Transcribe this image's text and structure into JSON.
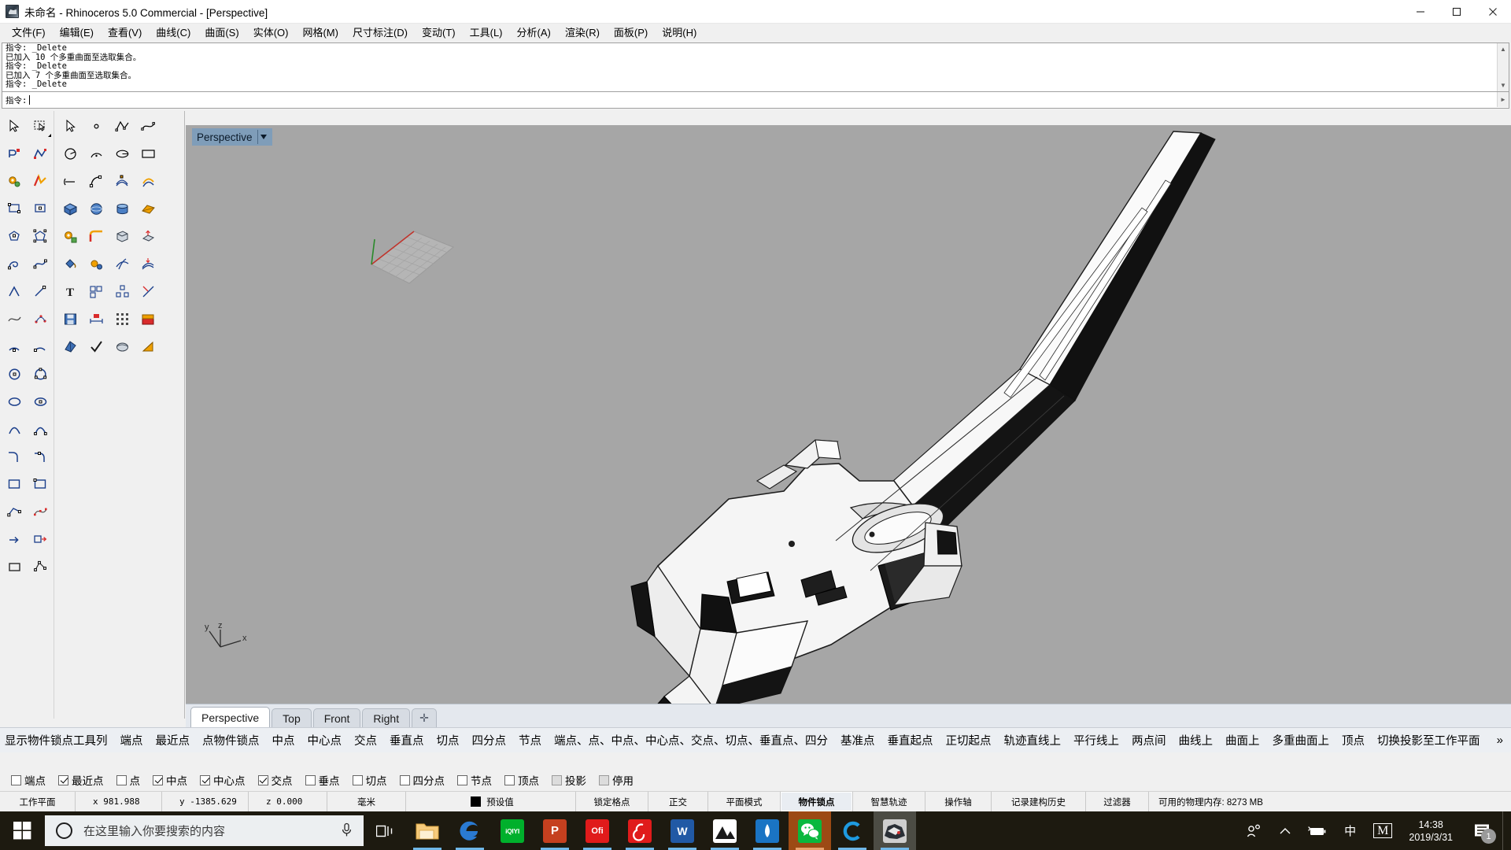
{
  "window": {
    "title": "未命名 - Rhinoceros 5.0 Commercial - [Perspective]",
    "icon": "rhino-logo-icon",
    "minimize_label": "最小化",
    "maximize_label": "最大化",
    "close_label": "关闭"
  },
  "menu": {
    "items": [
      {
        "label": "文件(F)"
      },
      {
        "label": "编辑(E)"
      },
      {
        "label": "查看(V)"
      },
      {
        "label": "曲线(C)"
      },
      {
        "label": "曲面(S)"
      },
      {
        "label": "实体(O)"
      },
      {
        "label": "网格(M)"
      },
      {
        "label": "尺寸标注(D)"
      },
      {
        "label": "变动(T)"
      },
      {
        "label": "工具(L)"
      },
      {
        "label": "分析(A)"
      },
      {
        "label": "渲染(R)"
      },
      {
        "label": "面板(P)"
      },
      {
        "label": "说明(H)"
      }
    ]
  },
  "command": {
    "history": [
      "指令: _Delete",
      "已加入 10 个多重曲面至选取集合。",
      "指令: _Delete",
      "已加入 7 个多重曲面至选取集合。",
      "指令: _Delete"
    ],
    "prompt_label": "指令: ",
    "prompt_value": "",
    "scroll_up": "▲",
    "scroll_down": "▼",
    "scroll_left": "◄",
    "scroll_right": "►"
  },
  "viewport": {
    "label": "Perspective",
    "dropdown_icon": "chevron-down-icon",
    "background_color": "#a6a6a6",
    "axis_labels": {
      "x": "x",
      "y": "y",
      "z": "z"
    },
    "tabs": [
      {
        "label": "Perspective",
        "active": true
      },
      {
        "label": "Top",
        "active": false
      },
      {
        "label": "Front",
        "active": false
      },
      {
        "label": "Right",
        "active": false
      }
    ],
    "add_tab_label": "✛"
  },
  "osnap_toolbar": {
    "items": [
      "显示物件锁点工具列",
      "端点",
      "最近点",
      "点物件锁点",
      "中点",
      "中心点",
      "交点",
      "垂直点",
      "切点",
      "四分点",
      "节点",
      "端点、点、中点、中心点、交点、切点、垂直点、四分",
      "基准点",
      "垂直起点",
      "正切起点",
      "轨迹直线上",
      "平行线上",
      "两点间",
      "曲线上",
      "曲面上",
      "多重曲面上",
      "顶点",
      "切换投影至工作平面"
    ],
    "overflow_label": "»"
  },
  "osnap_checks": [
    {
      "label": "端点",
      "checked": false,
      "disabled": false
    },
    {
      "label": "最近点",
      "checked": true,
      "disabled": false
    },
    {
      "label": "点",
      "checked": false,
      "disabled": false
    },
    {
      "label": "中点",
      "checked": true,
      "disabled": false
    },
    {
      "label": "中心点",
      "checked": true,
      "disabled": false
    },
    {
      "label": "交点",
      "checked": true,
      "disabled": false
    },
    {
      "label": "垂点",
      "checked": false,
      "disabled": false
    },
    {
      "label": "切点",
      "checked": false,
      "disabled": false
    },
    {
      "label": "四分点",
      "checked": false,
      "disabled": false
    },
    {
      "label": "节点",
      "checked": false,
      "disabled": false
    },
    {
      "label": "顶点",
      "checked": false,
      "disabled": false
    },
    {
      "label": "投影",
      "checked": false,
      "disabled": true
    },
    {
      "label": "停用",
      "checked": false,
      "disabled": true
    }
  ],
  "statusbar": {
    "cplane": "工作平面",
    "x": "x  981.988",
    "y": "y -1385.629",
    "z": "z  0.000",
    "units": "毫米",
    "layer": "预设值",
    "layer_color": "#000000",
    "toggles": [
      {
        "label": "锁定格点",
        "on": false
      },
      {
        "label": "正交",
        "on": false
      },
      {
        "label": "平面模式",
        "on": false
      },
      {
        "label": "物件锁点",
        "on": true
      },
      {
        "label": "智慧轨迹",
        "on": false
      },
      {
        "label": "操作轴",
        "on": false
      },
      {
        "label": "记录建构历史",
        "on": false
      },
      {
        "label": "过滤器",
        "on": false
      }
    ],
    "memory": "可用的物理内存:  8273 MB"
  },
  "taskbar": {
    "start_label": "开始",
    "search_placeholder": "在这里输入你要搜索的内容",
    "cortana_icon": "cortana-circle-icon",
    "mic_icon": "microphone-icon",
    "taskview_icon": "task-view-icon",
    "apps": [
      {
        "name": "file-explorer",
        "glyph": "",
        "bg": "#f5c16c",
        "fg": "#8a5a12",
        "running": true,
        "active": false
      },
      {
        "name": "microsoft-edge",
        "glyph": "e",
        "bg": "transparent",
        "fg": "#2a7ad2",
        "running": true,
        "active": false
      },
      {
        "name": "iqiyi",
        "glyph": "iQIYI",
        "bg": "#00b02c",
        "fg": "#ffffff",
        "running": false,
        "active": false
      },
      {
        "name": "powerpoint",
        "glyph": "P",
        "bg": "#c5401f",
        "fg": "#ffffff",
        "running": true,
        "active": false
      },
      {
        "name": "wps-office",
        "glyph": "Ofi",
        "bg": "#e01b1b",
        "fg": "#ffffff",
        "running": true,
        "active": false
      },
      {
        "name": "netease-music",
        "glyph": "",
        "bg": "#e01b1b",
        "fg": "#ffffff",
        "running": true,
        "active": false
      },
      {
        "name": "microsoft-word",
        "glyph": "W",
        "bg": "#2159a5",
        "fg": "#ffffff",
        "running": true,
        "active": false
      },
      {
        "name": "photos",
        "glyph": "",
        "bg": "#ffffff",
        "fg": "#222222",
        "running": true,
        "active": false
      },
      {
        "name": "microsoft-store",
        "glyph": "",
        "bg": "#1a74c4",
        "fg": "#ffffff",
        "running": true,
        "active": false
      },
      {
        "name": "wechat",
        "glyph": "",
        "bg": "#09b83e",
        "fg": "#ffffff",
        "running": true,
        "active": true
      },
      {
        "name": "360-browser",
        "glyph": "C",
        "bg": "transparent",
        "fg": "#1e9ae0",
        "running": true,
        "active": false
      },
      {
        "name": "rhinoceros",
        "glyph": "",
        "bg": "#cfcfcf",
        "fg": "#333333",
        "running": true,
        "active": false
      }
    ],
    "tray": {
      "people_icon": "people-icon",
      "chevron_icon": "show-hidden-icons-icon",
      "battery_icon": "battery-charging-icon",
      "ime_icon": "中",
      "mcafee_icon": "M",
      "time": "14:38",
      "date": "2019/3/31",
      "notification_icon": "action-center-icon",
      "notification_count": "1"
    }
  },
  "toolbar_left": {
    "columns": 2,
    "groups": "drawing-and-modeling-tools"
  }
}
